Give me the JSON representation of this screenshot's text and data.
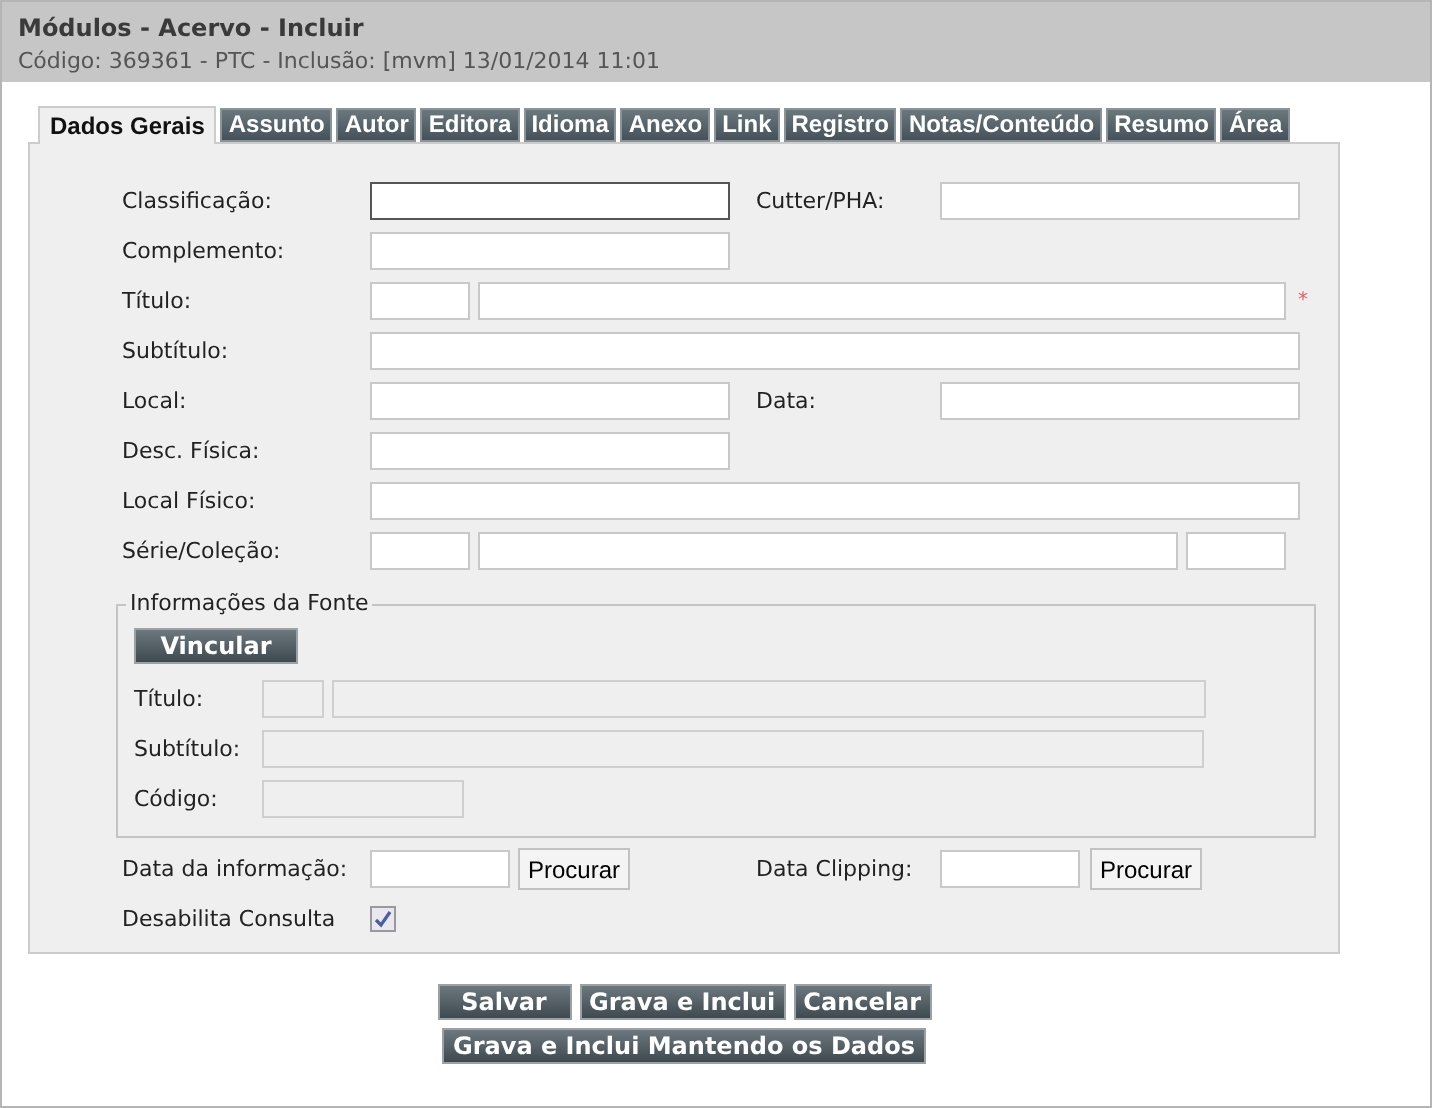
{
  "header": {
    "title": "Módulos - Acervo - Incluir",
    "subtitle": "Código: 369361 - PTC - Inclusão: [mvm] 13/01/2014 11:01"
  },
  "tabs": [
    {
      "label": "Dados Gerais",
      "selected": true
    },
    {
      "label": "Assunto",
      "selected": false
    },
    {
      "label": "Autor",
      "selected": false
    },
    {
      "label": "Editora",
      "selected": false
    },
    {
      "label": "Idioma",
      "selected": false
    },
    {
      "label": "Anexo",
      "selected": false
    },
    {
      "label": "Link",
      "selected": false
    },
    {
      "label": "Registro",
      "selected": false
    },
    {
      "label": "Notas/Conteúdo",
      "selected": false
    },
    {
      "label": "Resumo",
      "selected": false
    },
    {
      "label": "Área",
      "selected": false
    }
  ],
  "form": {
    "classificacao": {
      "label": "Classificação:",
      "focused": true
    },
    "cutter": {
      "label": "Cutter/PHA:"
    },
    "complemento": {
      "label": "Complemento:"
    },
    "titulo": {
      "label": "Título:",
      "required_mark": "*"
    },
    "subtitulo": {
      "label": "Subtítulo:"
    },
    "local": {
      "label": "Local:"
    },
    "data": {
      "label": "Data:"
    },
    "desc_fisica": {
      "label": "Desc. Física:"
    },
    "local_fisico": {
      "label": "Local Físico:"
    },
    "serie": {
      "label": "Série/Coleção:"
    }
  },
  "fonte": {
    "legend": "Informações da Fonte",
    "button": "Vincular",
    "titulo": "Título:",
    "subtitulo": "Subtítulo:",
    "codigo": "Código:",
    "disabled": true
  },
  "data_informacao": {
    "label": "Data da informação:",
    "button": "Procurar"
  },
  "data_clipping": {
    "label": "Data Clipping:",
    "button": "Procurar"
  },
  "desabilita": {
    "label": "Desabilita Consulta",
    "checked": true
  },
  "buttons": [
    "Salvar",
    "Grava e Inclui",
    "Cancelar",
    "Grava e Inclui Mantendo os Dados"
  ]
}
